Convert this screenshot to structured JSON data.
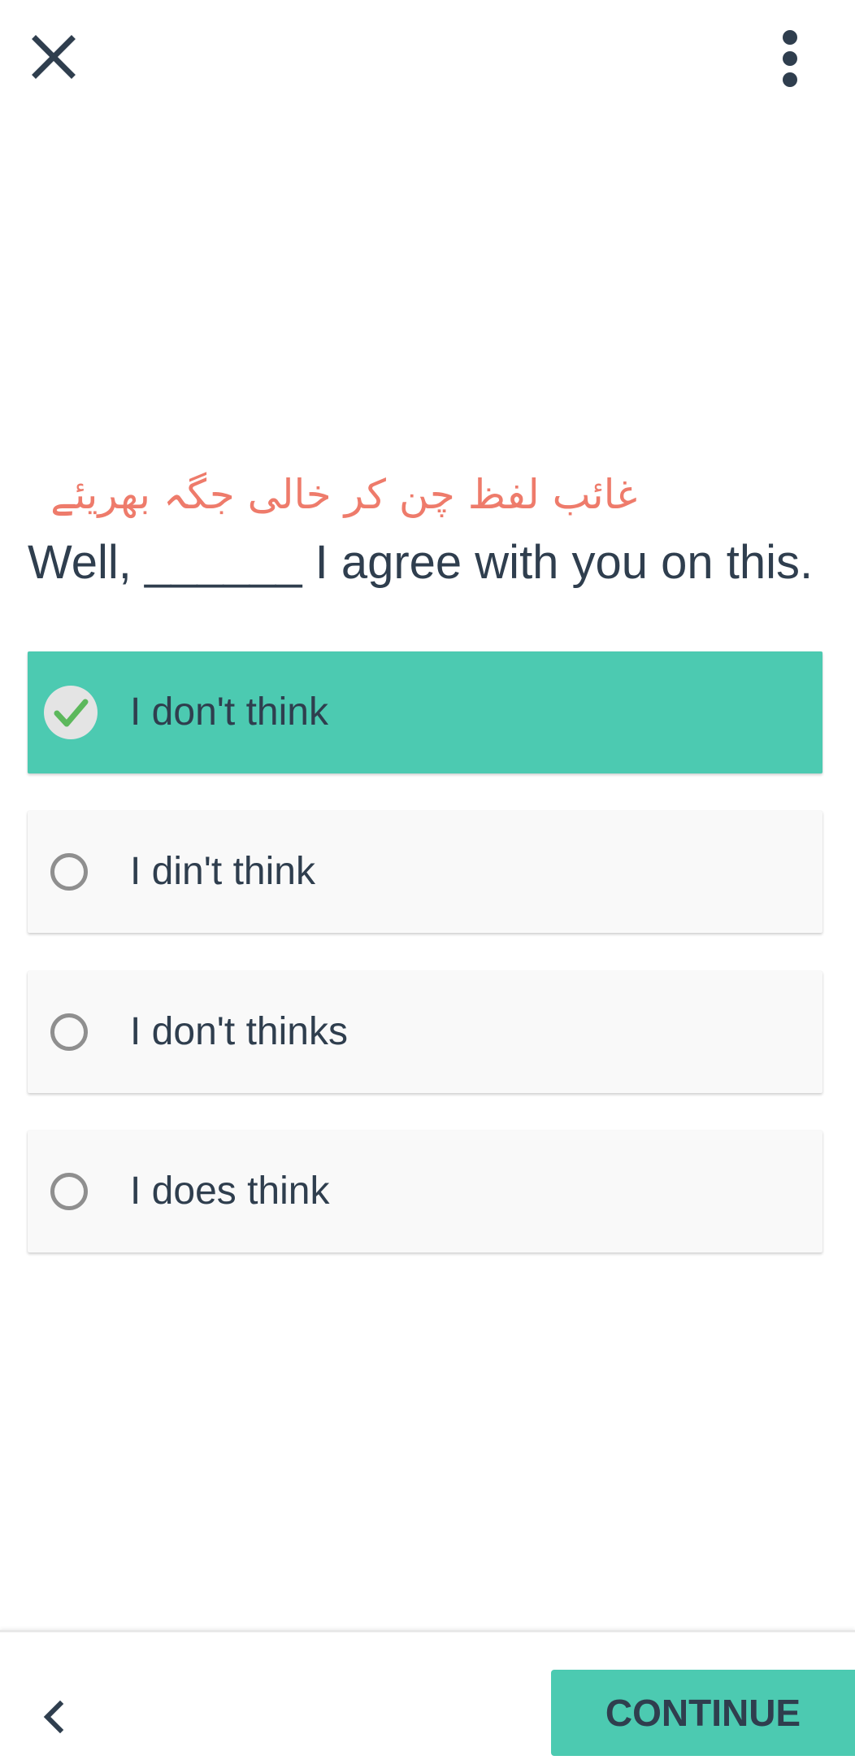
{
  "toolbar": {
    "close_icon": "close-icon",
    "more_icon": "more-vertical-icon"
  },
  "question": {
    "instruction": "غائب لفظ چن کر خالی جگہ بھریئے",
    "sentence": "Well, ______ I agree with you on this."
  },
  "options": [
    {
      "label": "I don't think",
      "selected": true
    },
    {
      "label": "I din't think",
      "selected": false
    },
    {
      "label": "I don't thinks",
      "selected": false
    },
    {
      "label": "I does think",
      "selected": false
    }
  ],
  "footer": {
    "back_icon": "chevron-left-icon",
    "continue_label": "CONTINUE"
  },
  "colors": {
    "accent": "#4ccab1",
    "instruction_text": "#ee7b6b",
    "body_text": "#2f3e4e",
    "option_background": "#f9f9f9",
    "check_green": "#5cb85c"
  }
}
